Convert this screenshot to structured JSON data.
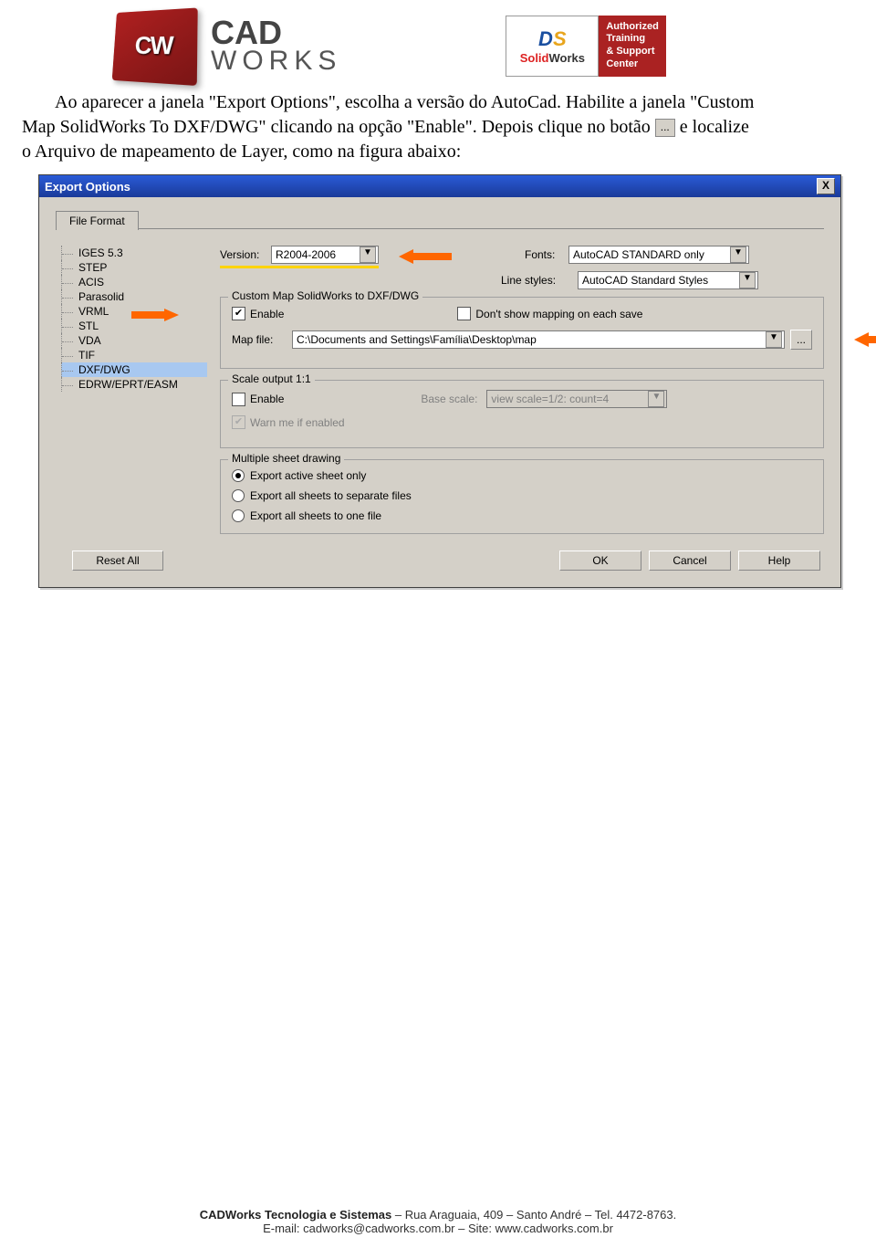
{
  "header": {
    "cadworks_logo_text": "CW",
    "cadworks_line1": "CAD",
    "cadworks_line2": "WORKS",
    "sw_brand1": "Solid",
    "sw_brand2": "Works",
    "atc_l1": "Authorized",
    "atc_l2": "Training",
    "atc_l3": "& Support",
    "atc_l4": "Center"
  },
  "text": {
    "p1a": "Ao aparecer a janela \"Export Options\", escolha a versão do AutoCad. Habilite a janela \"Custom",
    "p2a": "Map SolidWorks To DXF/DWG\" clicando na opção \"Enable\". Depois clique no botão ",
    "p2b": " e localize",
    "p3": "o Arquivo de mapeamento de Layer, como na figura abaixo:",
    "btn_dots": "..."
  },
  "dialog": {
    "title": "Export Options",
    "close": "X",
    "tab": "File Format",
    "tree": [
      "IGES 5.3",
      "STEP",
      "ACIS",
      "Parasolid",
      "VRML",
      "STL",
      "VDA",
      "TIF",
      "DXF/DWG",
      "EDRW/EPRT/EASM"
    ],
    "version_lbl": "Version:",
    "version_val": "R2004-2006",
    "fonts_lbl": "Fonts:",
    "fonts_val": "AutoCAD STANDARD only",
    "linestyles_lbl": "Line styles:",
    "linestyles_val": "AutoCAD Standard Styles",
    "grp_map": "Custom Map SolidWorks to DXF/DWG",
    "enable_lbl": "Enable",
    "dontshow_lbl": "Don't show mapping on each save",
    "mapfile_lbl": "Map file:",
    "mapfile_val": "C:\\Documents and Settings\\Família\\Desktop\\map",
    "browse": "...",
    "grp_scale": "Scale output 1:1",
    "scale_enable": "Enable",
    "base_scale_lbl": "Base scale:",
    "base_scale_val": "view scale=1/2: count=4",
    "warn_lbl": "Warn me if enabled",
    "grp_multi": "Multiple sheet drawing",
    "r1": "Export active sheet only",
    "r2": "Export all sheets to separate files",
    "r3": "Export all sheets to one file",
    "reset": "Reset All",
    "ok": "OK",
    "cancel": "Cancel",
    "help": "Help"
  },
  "footer": {
    "l1a": "CADWorks Tecnologia e Sistemas",
    "l1b": " – Rua Araguaia, 409 – Santo André – Tel. 4472-8763.",
    "l2": "E-mail: cadworks@cadworks.com.br – Site: www.cadworks.com.br"
  }
}
